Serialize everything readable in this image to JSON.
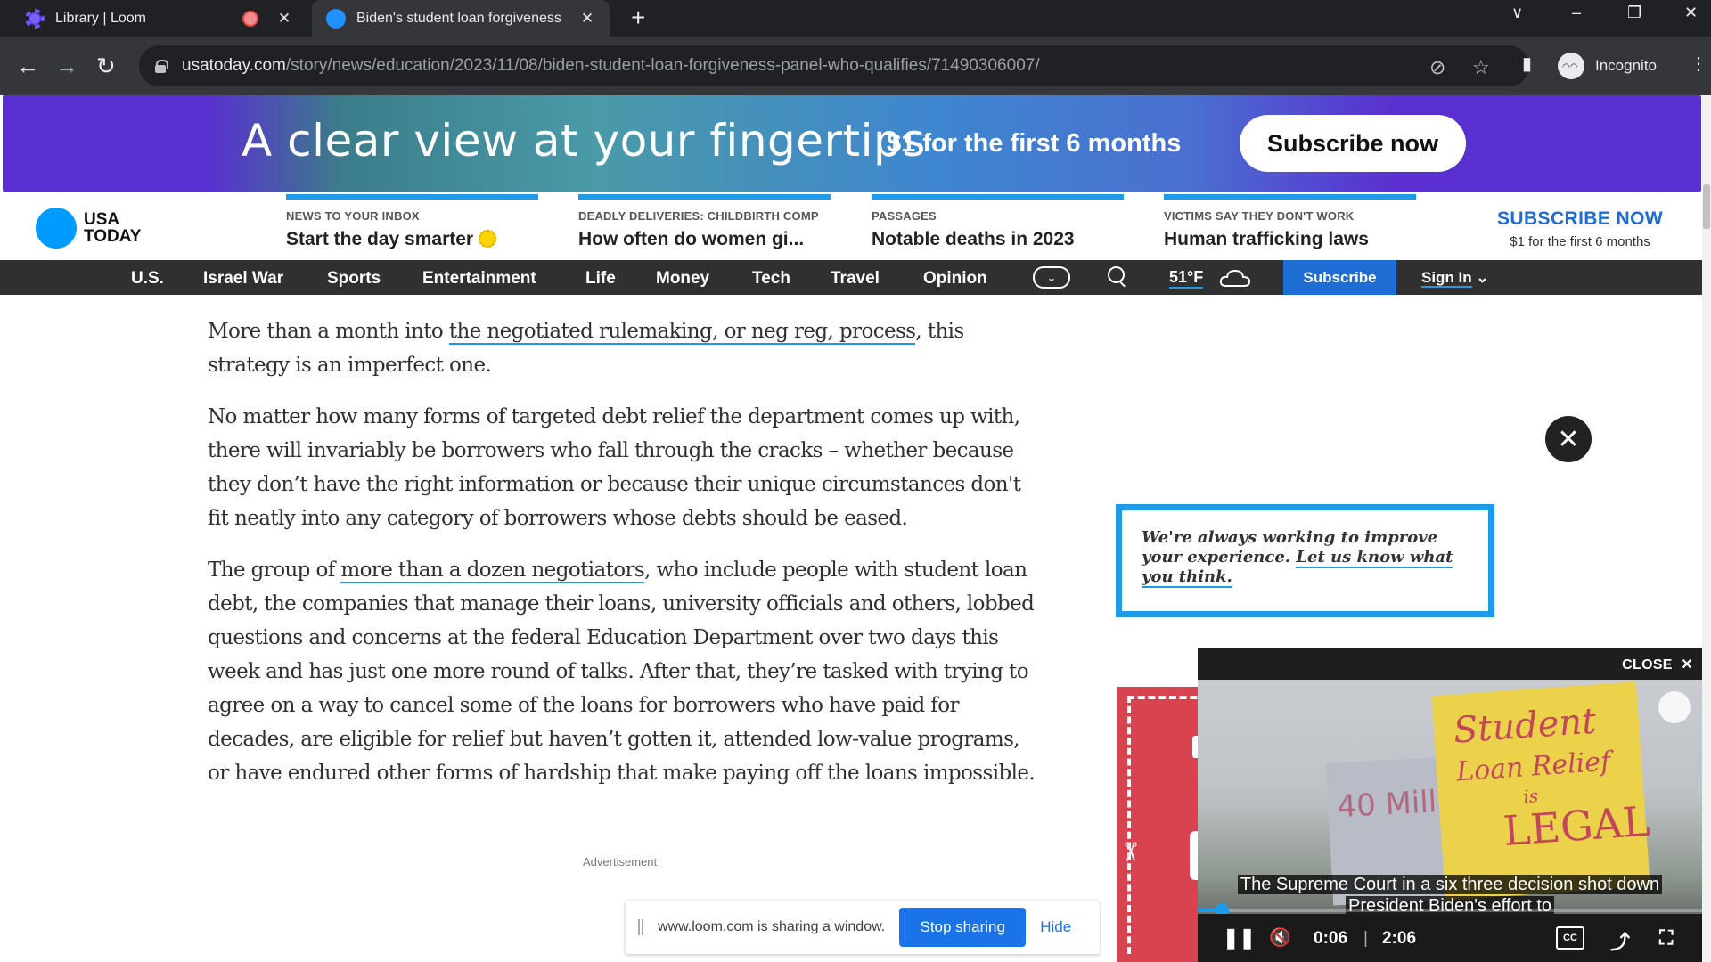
{
  "browser": {
    "tabs": [
      {
        "title": "Library | Loom",
        "active": false,
        "recording": true
      },
      {
        "title": "Biden's student loan forgiveness",
        "active": true,
        "recording": false
      }
    ],
    "new_tab_label": "+",
    "window_controls": {
      "tab_search": "∨",
      "minimize": "–",
      "restore": "❐",
      "close": "✕"
    },
    "url_host": "usatoday.com",
    "url_path": "/story/news/education/2023/11/08/biden-student-loan-forgiveness-panel-who-qualifies/71490306007/",
    "profile_label": "Incognito",
    "icons": {
      "back": "←",
      "forward": "→",
      "reload": "↻",
      "eye_off": "⊘",
      "star": "☆",
      "sidepanel": "▮",
      "menu": "⋮"
    }
  },
  "promo": {
    "headline": "A clear view at your fingertips",
    "offer": "$1 for the first 6 months",
    "button_label": "Subscribe now",
    "colors": {
      "purple": "#5a2fd0",
      "teal": "#4a9aa8"
    }
  },
  "masthead": {
    "logo_line1": "USA",
    "logo_line2": "TODAY",
    "logo_color": "#009bff",
    "teasers": [
      {
        "kicker": "NEWS TO YOUR INBOX",
        "headline": "Start the day smarter"
      },
      {
        "kicker": "DEADLY DELIVERIES: CHILDBIRTH COMP",
        "headline": "How often do women gi..."
      },
      {
        "kicker": "PASSAGES",
        "headline": "Notable deaths in 2023"
      },
      {
        "kicker": "VICTIMS SAY THEY DON'T WORK",
        "headline": "Human trafficking laws"
      }
    ],
    "subscribe_title": "SUBSCRIBE NOW",
    "subscribe_sub": "$1 for the first 6 months"
  },
  "nav": {
    "items": [
      "U.S.",
      "Israel War",
      "Sports",
      "Entertainment",
      "Life",
      "Money",
      "Tech",
      "Travel",
      "Opinion"
    ],
    "more_icon": "⌄",
    "weather": "51°F",
    "subscribe_label": "Subscribe",
    "signin_label": "Sign In",
    "signin_chevron": "⌄"
  },
  "article": {
    "p1_before": "More than a month into ",
    "p1_link": "the negotiated rulemaking, or neg reg, process",
    "p1_after": ", this strategy is an imperfect one.",
    "p2": "No matter how many forms of targeted debt relief the department comes up with, there will invariably be borrowers who fall through the cracks – whether because they don’t have the right information or because their unique circumstances don't fit neatly into any category of borrowers whose debts should be eased.",
    "p3_before": "The group of ",
    "p3_link": "more than a dozen negotiators",
    "p3_after": ", who include people with student loan debt, the companies that manage their loans, university officials and others, lobbed questions and concerns at the federal Education Department over two days this week and has just one more round of talks. After that, they’re tasked with trying to agree on a way to cancel some of the loans for borrowers who have paid for decades, are eligible for relief but haven’t gotten it, attended low-value programs, or have endured other forms of hardship that make paying off the loans impossible.",
    "ad_label": "Advertisement"
  },
  "sidebar": {
    "close_icon": "✕",
    "feedback_text": "We're always working to improve your experience. ",
    "feedback_link": "Let us know what you think."
  },
  "video": {
    "close_label": "CLOSE",
    "close_icon": "✕",
    "sign_text_yellow": [
      "Student",
      "Loan Relief",
      "is",
      "LEGAL"
    ],
    "sign_text_gray": "40 Mill",
    "caption_line1": "The Supreme Court in a six three decision shot down",
    "caption_line2": "President Biden's effort to",
    "current_time": "0:06",
    "separator": "|",
    "duration": "2:06",
    "progress_fraction": 0.048,
    "icons": {
      "pause": "❚❚",
      "mute": "🔇",
      "cc": "CC",
      "share": "⤴",
      "fullscreen": "⛶"
    }
  },
  "loom_bar": {
    "message": "www.loom.com is sharing a window.",
    "stop_label": "Stop sharing",
    "hide_label": "Hide"
  }
}
